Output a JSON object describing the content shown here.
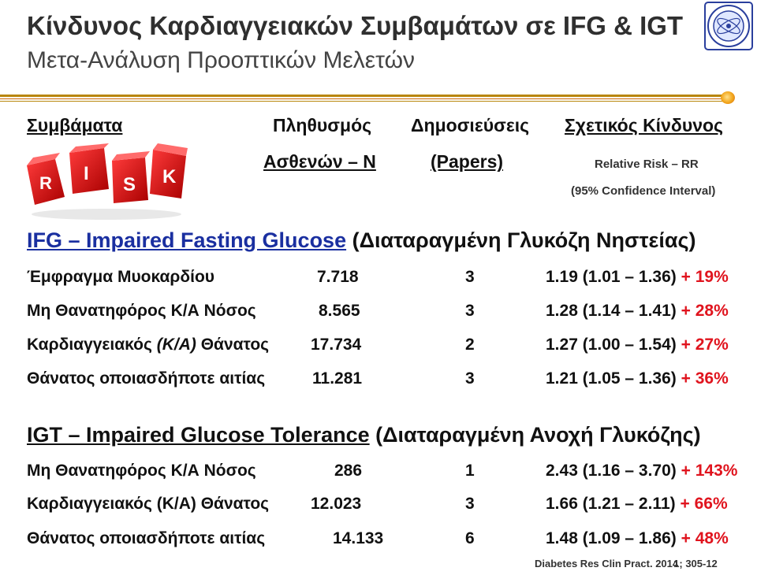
{
  "header": {
    "title": "Κίνδυνος Καρδιαγγειακών Συμβαμάτων σε IFG & IGT",
    "subtitle": "Μετα-Ανάλυση Προοπτικών Μελετών"
  },
  "columns": {
    "events": "Συμβάματα",
    "population_line1": "Πληθυσμός",
    "population_line2": "Ασθενών – N",
    "publications_line1": "Δημοσιεύσεις",
    "publications_line2": "(Papers)",
    "risk_line1": "Σχετικός Κίνδυνος",
    "risk_line2": "Relative Risk – RR",
    "risk_line3": "(95% Confidence Interval)"
  },
  "dice_letters": [
    "R",
    "I",
    "S",
    "K"
  ],
  "sections": [
    {
      "title_en": "IFG – Impaired Fasting Glucose",
      "title_gr": "(Διαταραγμένη Γλυκόζη Νηστείας)",
      "rows": [
        {
          "event": "Έμφραγμα Μυοκαρδίου",
          "n": "7.718",
          "papers": "3",
          "rr": "1.19 (1.01 – 1.36)",
          "plus": "+",
          "pct": "19%"
        },
        {
          "event": "Μη Θανατηφόρος Κ/Α Νόσος",
          "n": "8.565",
          "papers": "3",
          "rr": "1.28 (1.14 – 1.41)",
          "plus": "+",
          "pct": "28%"
        },
        {
          "event_a": "Καρδιαγγειακός ",
          "event_b": "(Κ/Α)",
          "event_c": " Θάνατος",
          "n": "17.734",
          "papers": "2",
          "rr": "1.27 (1.00 – 1.54)",
          "plus": "+",
          "pct": "27%"
        },
        {
          "event": "Θάνατος οποιασδήποτε αιτίας",
          "n": "11.281",
          "papers": "3",
          "rr": "1.21 (1.05 – 1.36)",
          "plus": "+",
          "pct": "36%"
        }
      ]
    },
    {
      "title_en": "IGT – Impaired Glucose Tolerance",
      "title_gr": "(Διαταραγμένη Ανοχή Γλυκόζης)",
      "rows": [
        {
          "event": "Μη Θανατηφόρος Κ/Α Νόσος",
          "n": "286",
          "papers": "1",
          "rr": "2.43 (1.16 – 3.70)",
          "plus": "+",
          "pct": "143%"
        },
        {
          "event": "Καρδιαγγειακός (Κ/Α) Θάνατος",
          "n": "12.023",
          "papers": "3",
          "rr": "1.66 (1.21 – 2.11)",
          "plus": "+",
          "pct": "66%"
        },
        {
          "event": "Θάνατος οποιασδήποτε αιτίας",
          "n": "14.133",
          "papers": "6",
          "rr": "1.48 (1.09 – 1.86)",
          "plus": "+",
          "pct": "48%"
        }
      ]
    }
  ],
  "citation": {
    "journal": "Diabetes Res Clin Pract.",
    "year": "2014",
    "overlap": "1",
    "pages": "305-12"
  },
  "colors": {
    "accent_red": "#e0141e",
    "section_blue": "#1a2fa0",
    "rule_gold": "#b8860b"
  }
}
